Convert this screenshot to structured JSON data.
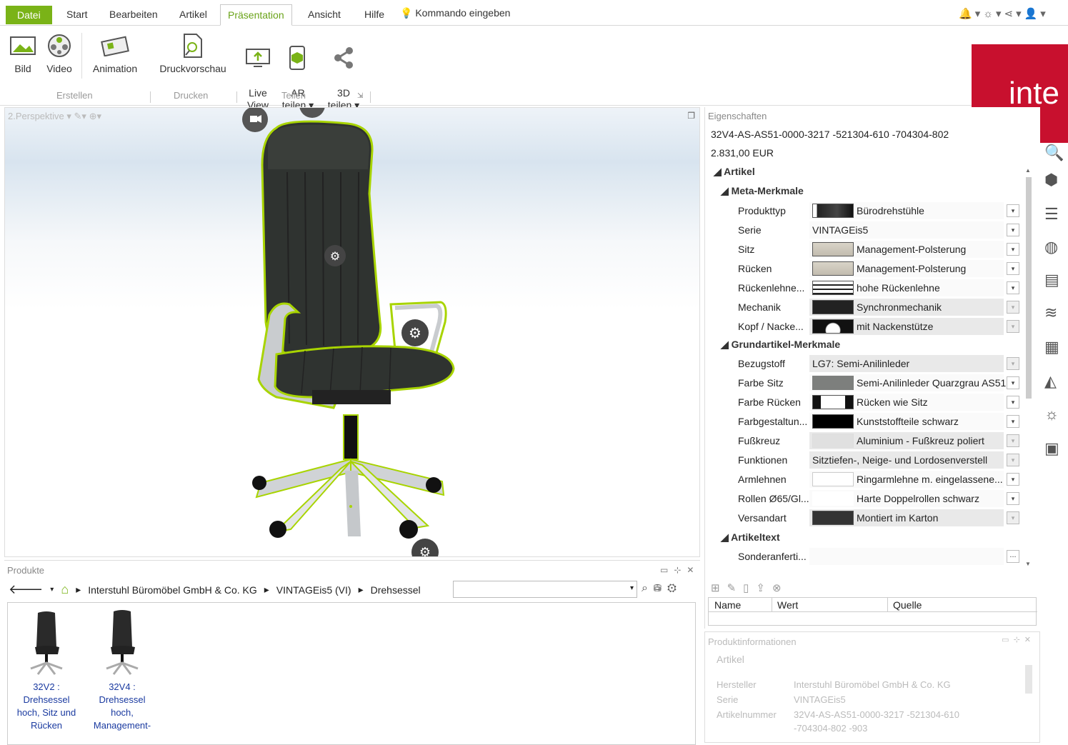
{
  "menubar": {
    "items": [
      "Datei",
      "Start",
      "Bearbeiten",
      "Artikel",
      "Präsentation",
      "Ansicht",
      "Hilfe"
    ],
    "command": "Kommando eingeben"
  },
  "ribbon": {
    "buttons": [
      {
        "label": "Bild",
        "icon": "image-icon"
      },
      {
        "label": "Video",
        "icon": "video-reel-icon"
      },
      {
        "label": "Animation",
        "icon": "film-icon"
      },
      {
        "label": "Druckvorschau",
        "icon": "print-preview-icon"
      },
      {
        "label": "Live\nView",
        "icon": "live-view-icon"
      },
      {
        "label": "AR\nteilen ▾",
        "icon": "ar-icon"
      },
      {
        "label": "3D\nteilen ▾",
        "icon": "share-icon"
      }
    ],
    "groups": [
      "Erstellen",
      "Drucken",
      "Teilen"
    ]
  },
  "viewport": {
    "label": "2.Perspektive ▾"
  },
  "products": {
    "title": "Produkte",
    "breadcrumb": [
      "Interstuhl Büromöbel GmbH & Co. KG",
      "VINTAGEis5 (VI)",
      "Drehsessel"
    ],
    "items": [
      {
        "label": "32V2 :\nDrehsessel\nhoch, Sitz und\nRücken"
      },
      {
        "label": "32V4 :\nDrehsessel\nhoch,\nManagement-"
      }
    ]
  },
  "properties": {
    "title": "Eigenschaften",
    "article_code": "32V4-AS-AS51-0000-3217 -521304-610 -704304-802",
    "price": "2.831,00 EUR",
    "sections": {
      "artikel": "Artikel",
      "meta": "Meta-Merkmale",
      "grund": "Grundartikel-Merkmale",
      "text": "Artikeltext"
    },
    "meta_rows": [
      {
        "label": "Produkttyp",
        "value": "Bürodrehstühle"
      },
      {
        "label": "Serie",
        "value": "VINTAGEis5"
      },
      {
        "label": "Sitz",
        "value": "Management-Polsterung"
      },
      {
        "label": "Rücken",
        "value": "Management-Polsterung"
      },
      {
        "label": "Rückenlehne...",
        "value": "hohe Rückenlehne"
      },
      {
        "label": "Mechanik",
        "value": "Synchronmechanik"
      },
      {
        "label": "Kopf / Nacke...",
        "value": "mit Nackenstütze"
      }
    ],
    "grund_rows": [
      {
        "label": "Bezugstoff",
        "value": "LG7: Semi-Anilinleder"
      },
      {
        "label": "Farbe Sitz",
        "value": "Semi-Anilinleder Quarzgrau AS51"
      },
      {
        "label": "Farbe Rücken",
        "value": "Rücken wie Sitz"
      },
      {
        "label": "Farbgestaltun...",
        "value": "Kunststoffteile schwarz"
      },
      {
        "label": "Fußkreuz",
        "value": "Aluminium - Fußkreuz poliert"
      },
      {
        "label": "Funktionen",
        "value": "Sitztiefen-, Neige- und Lordosenverstell"
      },
      {
        "label": "Armlehnen",
        "value": "Ringarmlehne m. eingelassene..."
      },
      {
        "label": "Rollen Ø65/Gl...",
        "value": "Harte Doppelrollen schwarz"
      },
      {
        "label": "Versandart",
        "value": "Montiert im Karton"
      }
    ],
    "text_rows": [
      {
        "label": "Sonderanferti...",
        "value": "..."
      }
    ],
    "table_headers": [
      "Name",
      "Wert",
      "Quelle"
    ]
  },
  "info": {
    "title": "Produktinformationen",
    "section": "Artikel",
    "rows": [
      {
        "label": "Hersteller",
        "value": "Interstuhl Büromöbel GmbH & Co. KG"
      },
      {
        "label": "Serie",
        "value": "VINTAGEis5"
      },
      {
        "label": "Artikelnummer",
        "value": "32V4-AS-AS51-0000-3217 -521304-610"
      },
      {
        "label": "",
        "value": "-704304-802 -903"
      }
    ]
  },
  "logo": {
    "text": "inte"
  },
  "colors": {
    "accent": "#7ab317",
    "highlight": "#a8d400",
    "brand": "#c8102e"
  }
}
